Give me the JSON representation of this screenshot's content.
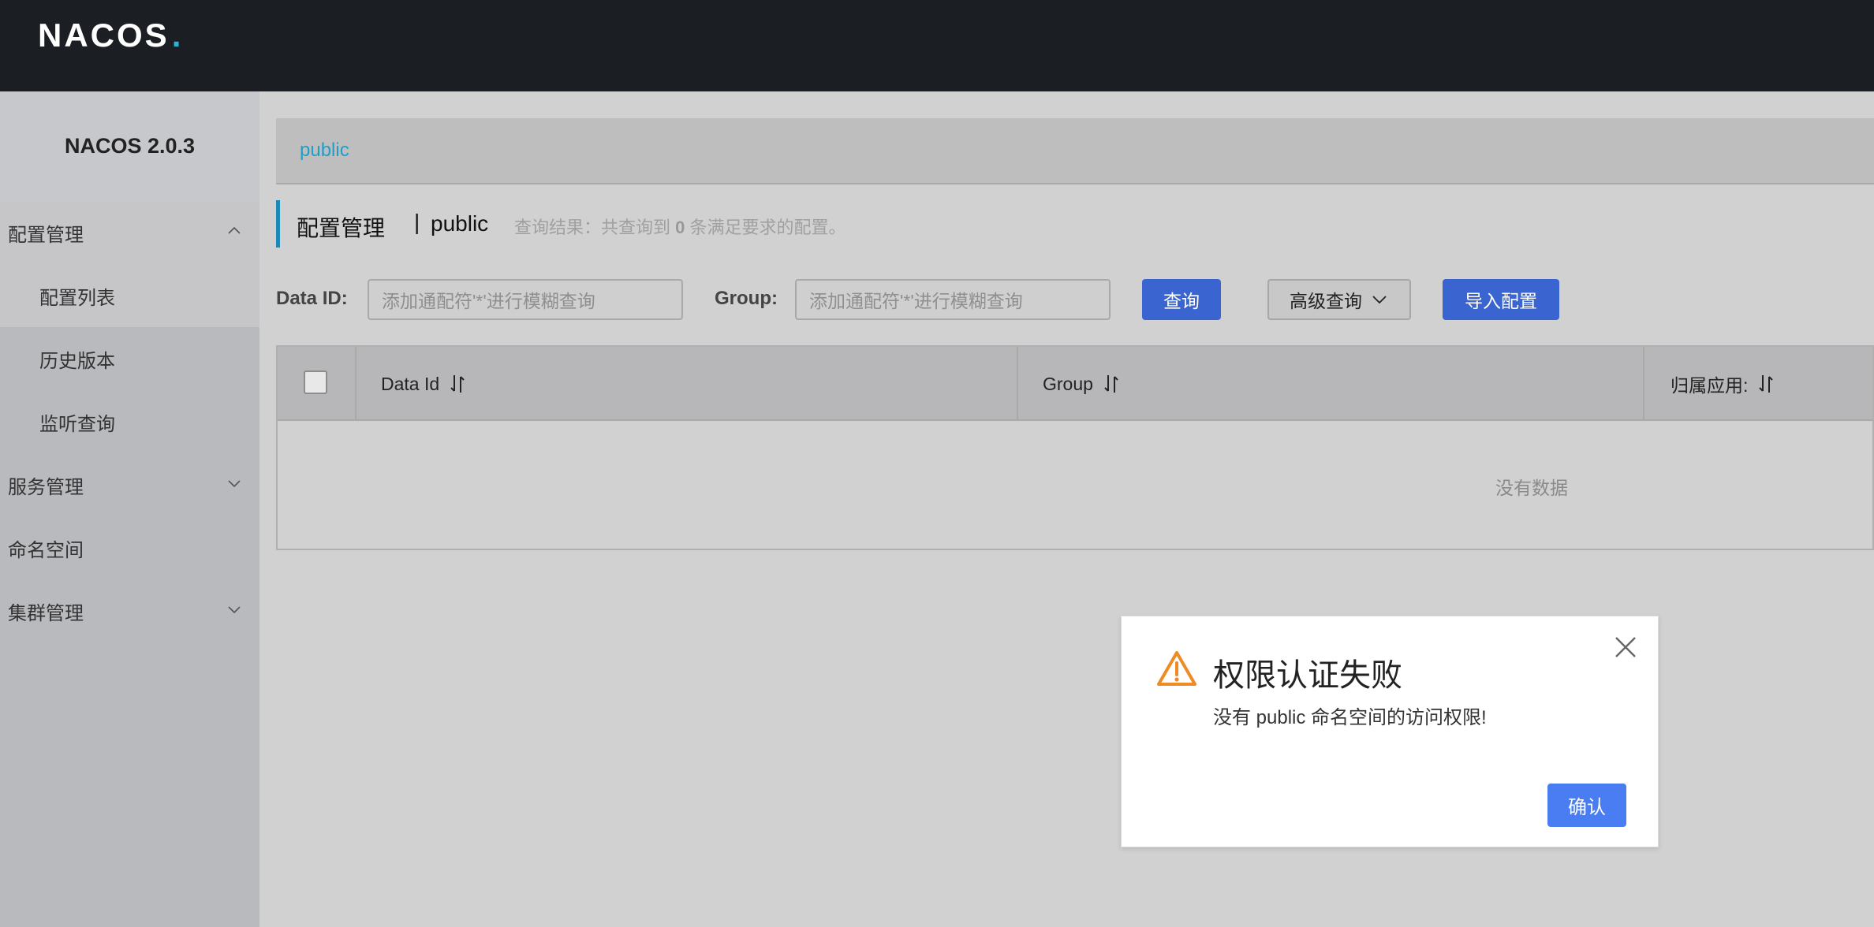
{
  "app": {
    "logo_text": "NACOS",
    "logo_dot": ".",
    "version": "NACOS 2.0.3"
  },
  "sidebar": {
    "items": [
      {
        "label": "配置管理",
        "icon": "chevron-up-icon"
      },
      {
        "label": "配置列表"
      },
      {
        "label": "历史版本"
      },
      {
        "label": "监听查询"
      },
      {
        "label": "服务管理",
        "icon": "chevron-down-icon"
      },
      {
        "label": "命名空间"
      },
      {
        "label": "集群管理",
        "icon": "chevron-down-icon"
      }
    ]
  },
  "namespace": {
    "current": "public"
  },
  "header": {
    "title": "配置管理",
    "separator": "|",
    "namespace": "public",
    "result_prefix": "查询结果：共查询到",
    "result_count": "0",
    "result_suffix": "条满足要求的配置。"
  },
  "search": {
    "data_id_label": "Data ID:",
    "data_id_placeholder": "添加通配符'*'进行模糊查询",
    "group_label": "Group:",
    "group_placeholder": "添加通配符'*'进行模糊查询",
    "query_button": "查询",
    "advanced_button": "高级查询",
    "import_button": "导入配置"
  },
  "table": {
    "columns": [
      "Data Id",
      "Group",
      "归属应用:"
    ],
    "empty_text": "没有数据"
  },
  "dialog": {
    "title": "权限认证失败",
    "message": "没有 public 命名空间的访问权限!",
    "confirm": "确认"
  },
  "colors": {
    "primary": "#3a65d1",
    "link": "#1f9ec6",
    "accent_bar": "#1b8ab8",
    "warning": "#f08a24"
  }
}
